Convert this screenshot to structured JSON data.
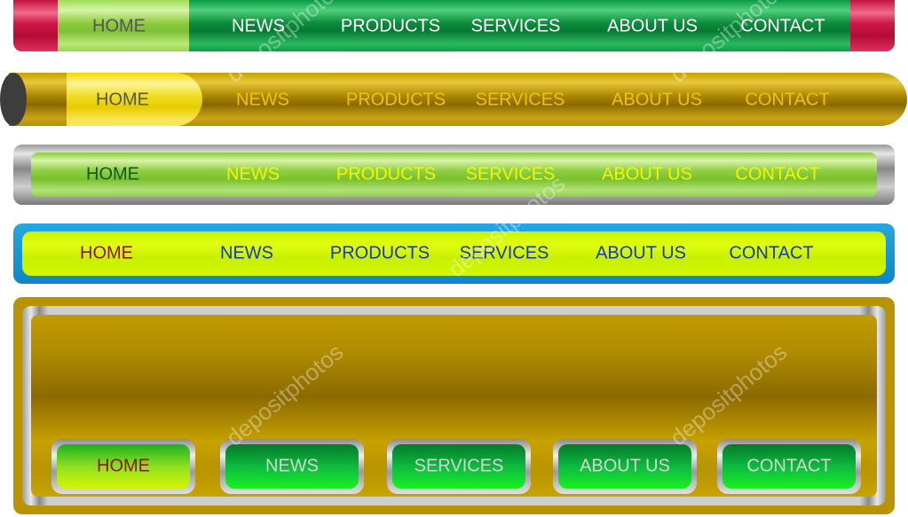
{
  "menus": [
    {
      "style": "green-red-caps",
      "items": [
        "HOME",
        "NEWS",
        "PRODUCTS",
        "SERVICES",
        "ABOUT US",
        "CONTACT"
      ],
      "active": "HOME"
    },
    {
      "style": "gold-cylinder",
      "items": [
        "HOME",
        "NEWS",
        "PRODUCTS",
        "SERVICES",
        "ABOUT US",
        "CONTACT"
      ],
      "active": "HOME"
    },
    {
      "style": "silver-green",
      "items": [
        "HOME",
        "NEWS",
        "PRODUCTS",
        "SERVICES",
        "ABOUT US",
        "CONTACT"
      ],
      "active": "HOME"
    },
    {
      "style": "blue-lime",
      "items": [
        "HOME",
        "NEWS",
        "PRODUCTS",
        "SERVICES",
        "ABOUT US",
        "CONTACT"
      ],
      "active": "HOME"
    },
    {
      "style": "gold-panel-buttons",
      "items": [
        "HOME",
        "NEWS",
        "SERVICES",
        "ABOUT US",
        "CONTACT"
      ],
      "active": "HOME"
    }
  ],
  "watermark": "depositphotos",
  "colors": {
    "bar1_text": "#ffffff",
    "bar1_active": "#555555",
    "bar2_text": "#f2c200",
    "bar2_active": "#555555",
    "bar3_text": "#f5f500",
    "bar3_active": "#0b5a2a",
    "bar4_text": "#1a3aa8",
    "bar4_active": "#8a1a00"
  }
}
